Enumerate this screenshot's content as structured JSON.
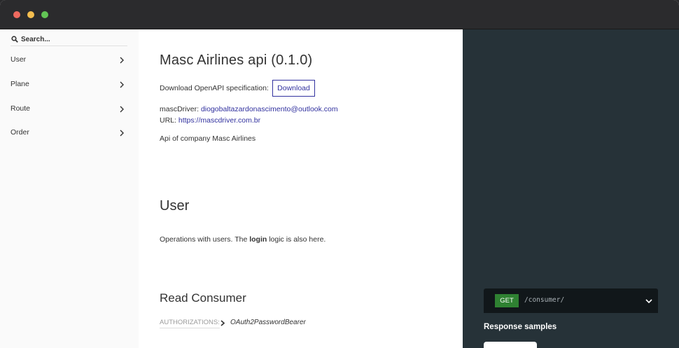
{
  "search": {
    "placeholder": "Search..."
  },
  "sidebar": {
    "items": [
      {
        "label": "User"
      },
      {
        "label": "Plane"
      },
      {
        "label": "Route"
      },
      {
        "label": "Order"
      }
    ]
  },
  "main": {
    "title": "Masc Airlines api (0.1.0)",
    "download_text": "Download OpenAPI specification:",
    "download_label": "Download",
    "contact_name_label": "mascDriver:",
    "contact_email": "diogobaltazardonascimento@outlook.com",
    "url_label": "URL:",
    "url": "https://mascdriver.com.br",
    "description": "Api of company Masc Airlines",
    "section_title": "User",
    "section_desc_prefix": "Operations with users. The ",
    "section_desc_bold": "login",
    "section_desc_suffix": " logic is also here.",
    "operation_title": "Read Consumer",
    "auth_label": "AUTHORIZATIONS:",
    "auth_value": "OAuth2PasswordBearer"
  },
  "right": {
    "method": "GET",
    "path": "/consumer/",
    "response_samples": "Response samples"
  },
  "colors": {
    "accent": "#32329f",
    "get_method": "#2f8132",
    "right_panel": "#263238"
  }
}
